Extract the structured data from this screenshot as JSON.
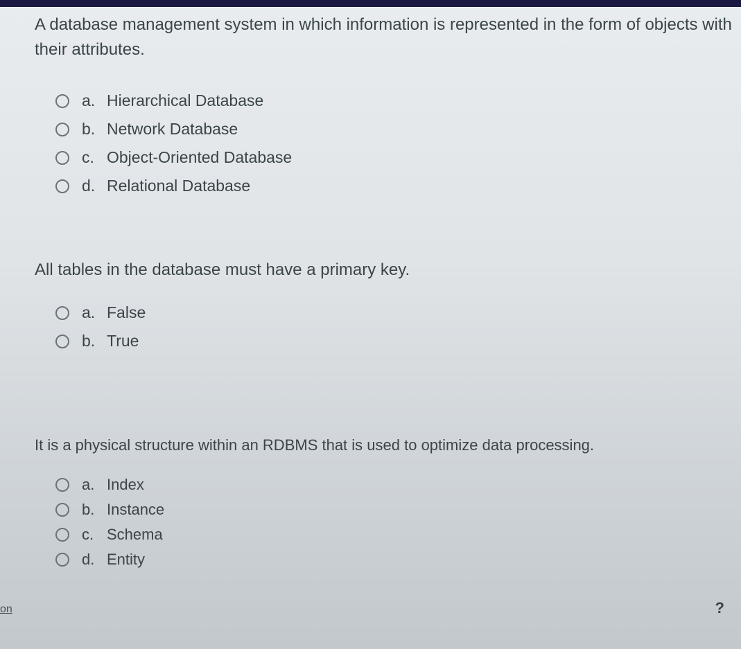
{
  "questions": [
    {
      "prompt": "A database management system in which information is represented in the form of objects with their attributes.",
      "options": [
        {
          "letter": "a.",
          "text": "Hierarchical Database"
        },
        {
          "letter": "b.",
          "text": "Network Database"
        },
        {
          "letter": "c.",
          "text": "Object-Oriented Database"
        },
        {
          "letter": "d.",
          "text": "Relational Database"
        }
      ]
    },
    {
      "prompt": "All tables in the database must have a primary key.",
      "options": [
        {
          "letter": "a.",
          "text": "False"
        },
        {
          "letter": "b.",
          "text": "True"
        }
      ]
    },
    {
      "prompt": "It is a physical structure within an RDBMS that is used to optimize data processing.",
      "options": [
        {
          "letter": "a.",
          "text": "Index"
        },
        {
          "letter": "b.",
          "text": "Instance"
        },
        {
          "letter": "c.",
          "text": "Schema"
        },
        {
          "letter": "d.",
          "text": "Entity"
        }
      ]
    }
  ],
  "corner": {
    "bl": "on",
    "br": "?"
  }
}
